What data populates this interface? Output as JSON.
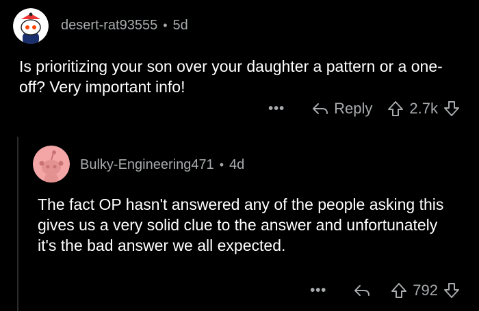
{
  "comments": [
    {
      "username": "desert-rat93555",
      "separator": "•",
      "age": "5d",
      "body": "Is prioritizing your son over your daughter a pattern or a one-off? Very important info!",
      "more": "•••",
      "reply_label": "Reply",
      "votes": "2.7k",
      "avatar_bg": "#ffffff"
    },
    {
      "username": "Bulky-Engineering471",
      "separator": "•",
      "age": "4d",
      "body": "The fact OP hasn't answered any of the people asking this gives us a very solid clue to the answer and unfortunately it's the bad answer we all expected.",
      "more": "•••",
      "votes": "792",
      "avatar_bg": "#f4a6a6"
    }
  ],
  "colors": {
    "background": "#000000",
    "text": "#ffffff",
    "meta": "#a8abad"
  }
}
